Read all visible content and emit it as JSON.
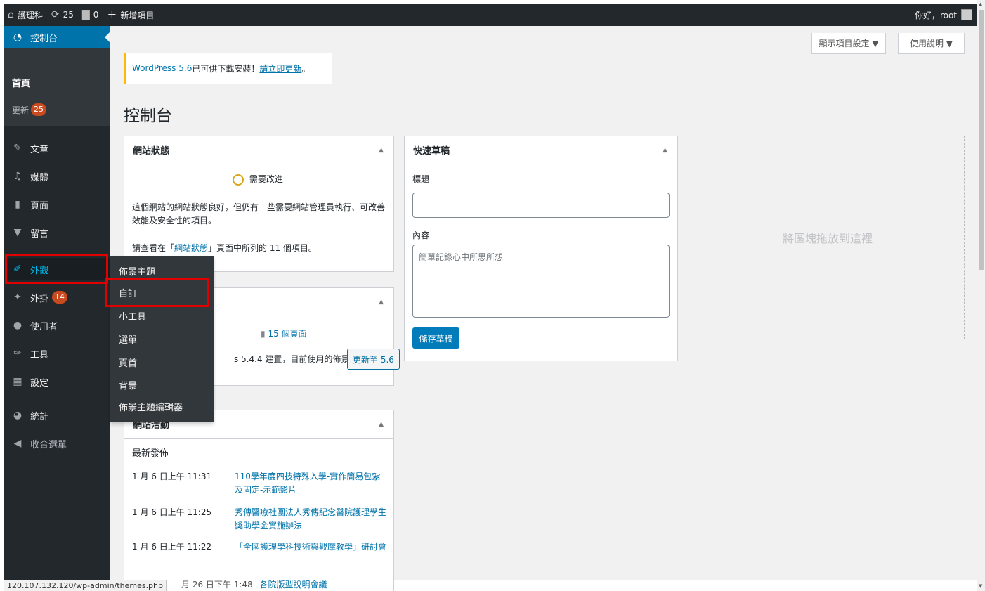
{
  "admin_bar": {
    "site_name": "護理科",
    "updates_count": "25",
    "comments_count": "0",
    "new_label": "新增項目",
    "greeting": "你好，root"
  },
  "sidebar": {
    "items": [
      {
        "label": "控制台",
        "icon": "dashboard-icon"
      },
      {
        "label": "文章",
        "icon": "pin-icon"
      },
      {
        "label": "媒體",
        "icon": "media-icon"
      },
      {
        "label": "頁面",
        "icon": "page-icon"
      },
      {
        "label": "留言",
        "icon": "comment-icon"
      },
      {
        "label": "外觀",
        "icon": "brush-icon"
      },
      {
        "label": "外掛",
        "icon": "plugin-icon",
        "badge": "14"
      },
      {
        "label": "使用者",
        "icon": "users-icon"
      },
      {
        "label": "工具",
        "icon": "wrench-icon"
      },
      {
        "label": "設定",
        "icon": "settings-icon"
      },
      {
        "label": "統計",
        "icon": "chart-icon"
      },
      {
        "label": "收合選單",
        "icon": "collapse-icon"
      }
    ],
    "submenu": {
      "home": "首頁",
      "update": "更新",
      "update_badge": "25"
    }
  },
  "appearance_flyout": [
    "佈景主題",
    "自訂",
    "小工具",
    "選單",
    "頁首",
    "背景",
    "佈景主題編輯器"
  ],
  "screen_meta": {
    "options": "顯示項目設定 ▼",
    "help": "使用說明 ▼"
  },
  "notice": {
    "link1": "WordPress 5.6",
    "text": " 已可供下載安裝！",
    "link2": "請立即更新",
    "end": "。"
  },
  "page_title": "控制台",
  "site_health": {
    "title": "網站狀態",
    "status": "需要改進",
    "description": "這個網站的網站狀態良好，但仍有一些需要網站管理員執行、可改善效能及安全性的項目。",
    "footer_pre": "請查看在「",
    "footer_link": "網站狀態",
    "footer_post": "」頁面中所列的 11 個項目。"
  },
  "at_a_glance": {
    "pages": "15 個頁面",
    "version_text": "s 5.4.4 建置，目前使用的佈景",
    "update_button": "更新至 5.6"
  },
  "activity": {
    "title": "網站活動",
    "subtitle": "最新發佈",
    "posts": [
      {
        "date": "1 月 6 日上午 11:31",
        "title": "110學年度四技特殊入學-實作簡易包紮及固定-示範影片"
      },
      {
        "date": "1 月 6 日上午 11:25",
        "title": "秀傳醫療社團法人秀傳紀念醫院護理學生獎助學金實施辦法"
      },
      {
        "date": "1 月 6 日上午 11:22",
        "title": "「全國護理學科技術與觀摩教學」研討會"
      },
      {
        "date": "月 26 日下午 1:48",
        "title": "各院版型說明會議"
      }
    ]
  },
  "quick_draft": {
    "title": "快速草稿",
    "title_label": "標題",
    "content_label": "內容",
    "content_placeholder": "簡單記錄心中所思所想",
    "save_button": "儲存草稿"
  },
  "drop_zone": "將區塊拖放到這裡",
  "status_url": "120.107.132.120/wp-admin/themes.php"
}
